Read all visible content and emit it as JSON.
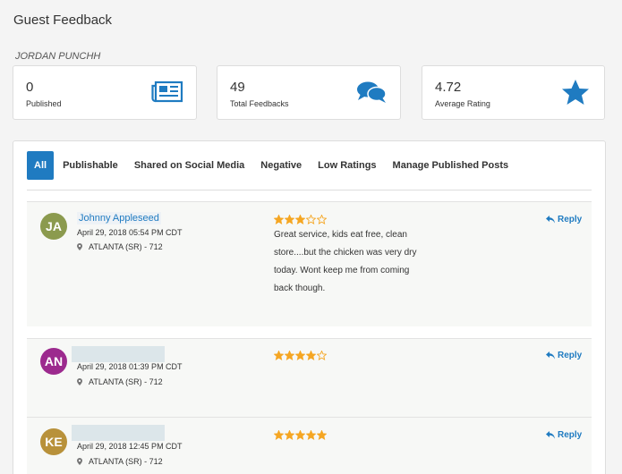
{
  "page": {
    "title": "Guest Feedback",
    "account": "JORDAN PUNCHH"
  },
  "stats": {
    "published": {
      "value": "0",
      "label": "Published",
      "icon": "newspaper-icon"
    },
    "feedbacks": {
      "value": "49",
      "label": "Total Feedbacks",
      "icon": "chat-bubbles-icon"
    },
    "rating": {
      "value": "4.72",
      "label": "Average Rating",
      "icon": "star-icon"
    }
  },
  "tabs": [
    "All",
    "Publishable",
    "Shared on Social Media",
    "Negative",
    "Low Ratings",
    "Manage Published Posts"
  ],
  "active_tab": "All",
  "reviews": [
    {
      "initials": "JA",
      "avatar_color": "#8b9a4e",
      "name": "Johnny Appleseed",
      "date": "April 29, 2018 05:54 PM CDT",
      "location": "ATLANTA (SR) - 712",
      "rating": 3,
      "text_lines": [
        "Great service, kids eat free, clean",
        "store....but the chicken was very dry",
        "today. Wont keep me from coming",
        "back though."
      ],
      "reply_label": "Reply"
    },
    {
      "initials": "AN",
      "avatar_color": "#9c2a8e",
      "name": "",
      "date": "April 29, 2018 01:39 PM CDT",
      "location": "ATLANTA (SR) - 712",
      "rating": 4,
      "text_lines": [],
      "reply_label": "Reply"
    },
    {
      "initials": "KE",
      "avatar_color": "#b8913a",
      "name": "",
      "date": "April 29, 2018 12:45 PM CDT",
      "location": "ATLANTA (SR) - 712",
      "rating": 5,
      "text_lines": [],
      "reply_label": "Reply"
    }
  ],
  "colors": {
    "accent": "#1f7bc1",
    "star": "#f5a623"
  }
}
